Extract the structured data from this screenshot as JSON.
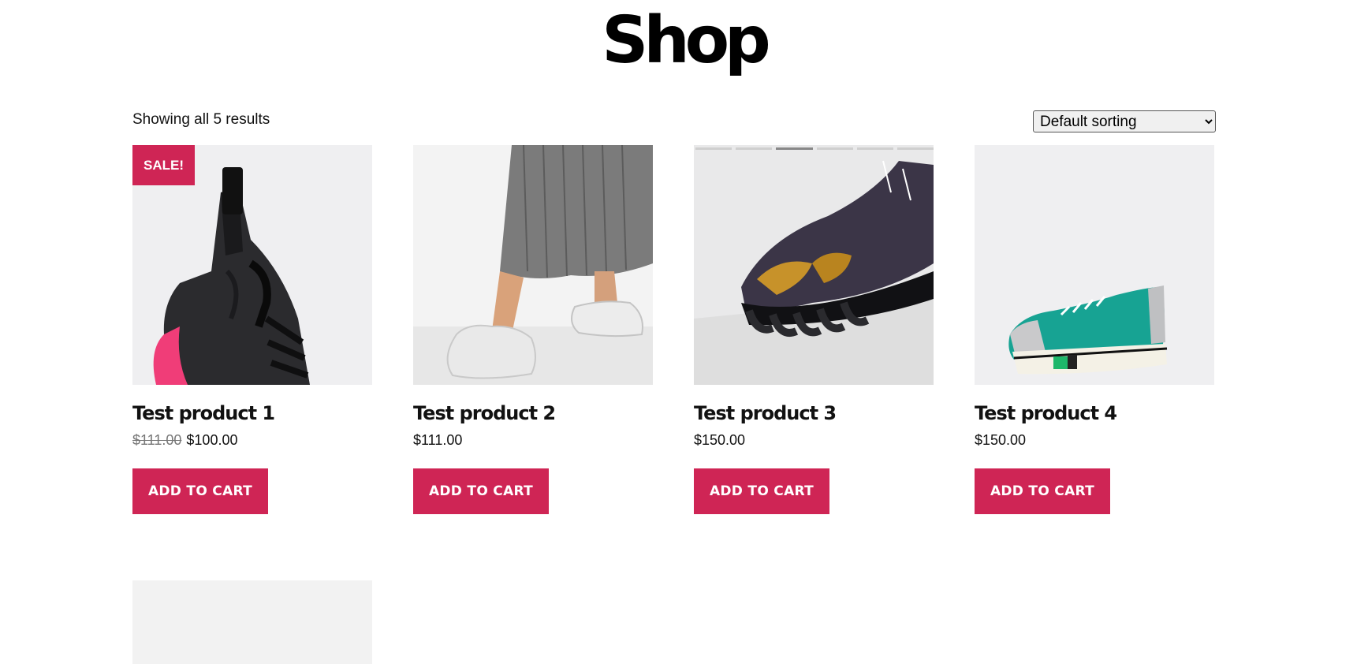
{
  "page": {
    "title": "Shop"
  },
  "toolbar": {
    "result_count": "Showing all 5 results",
    "sort_selected": "Default sorting"
  },
  "colors": {
    "accent": "#cf2555",
    "text": "#111111"
  },
  "products": [
    {
      "title": "Test product 1",
      "regular_price": "$111.00",
      "sale_price": "$100.00",
      "badge": "SALE!",
      "button": "ADD TO CART",
      "image": "black-pink-sole-boot"
    },
    {
      "title": "Test product 2",
      "price": "$111.00",
      "button": "ADD TO CART",
      "image": "white-sneakers-grey-skirt"
    },
    {
      "title": "Test product 3",
      "price": "$150.00",
      "button": "ADD TO CART",
      "image": "black-gold-baroque-sneaker",
      "gallery_active_index": 3,
      "gallery_count": 6
    },
    {
      "title": "Test product 4",
      "price": "$150.00",
      "button": "ADD TO CART",
      "image": "teal-knit-sneaker"
    },
    {
      "image": "placeholder-image"
    }
  ]
}
